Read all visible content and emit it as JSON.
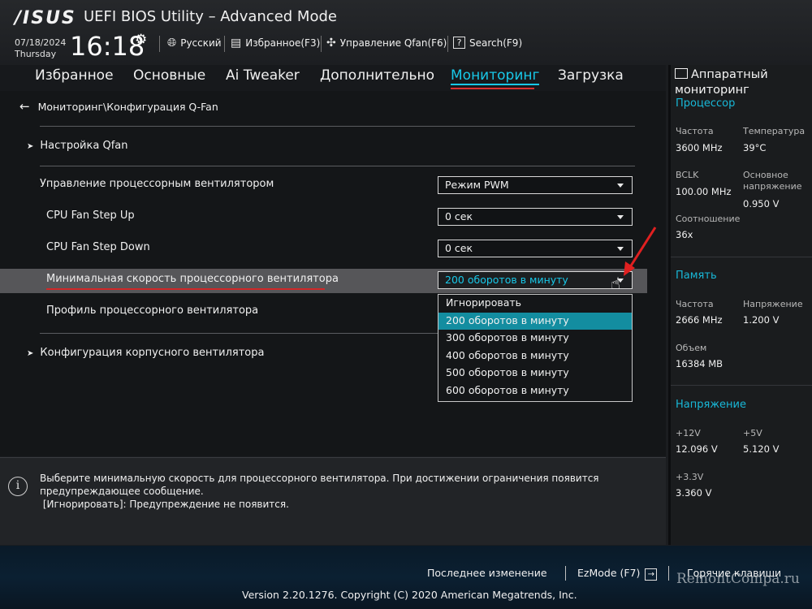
{
  "header": {
    "logo": "/ISUS",
    "title": "UEFI BIOS Utility – Advanced Mode",
    "date": "07/18/2024",
    "weekday": "Thursday",
    "time": "16:18",
    "language": "Русский",
    "favorites": "Избранное(F3)",
    "qfan": "Управление Qfan(F6)",
    "search_key": "?",
    "search": "Search(F9)"
  },
  "tabs": [
    {
      "label": "Избранное"
    },
    {
      "label": "Основные"
    },
    {
      "label": "Ai Tweaker"
    },
    {
      "label": "Дополнительно"
    },
    {
      "label": "Мониторинг",
      "active": true
    },
    {
      "label": "Загрузка"
    }
  ],
  "breadcrumb": "Мониторинг\\Конфигурация Q-Fan",
  "main": {
    "qfan_settings": "Настройка Qfan",
    "cpu_fan_control": {
      "label": "Управление процессорным вентилятором",
      "value": "Режим PWM"
    },
    "step_up": {
      "label": "CPU Fan Step Up",
      "value": "0 сек"
    },
    "step_down": {
      "label": "CPU Fan Step Down",
      "value": "0 сек"
    },
    "min_speed": {
      "label": "Минимальная скорость процессорного вентилятора",
      "value": "200 оборотов в минуту"
    },
    "fan_profile": {
      "label": "Профиль процессорного вентилятора"
    },
    "chassis_config": "Конфигурация корпусного вентилятора",
    "options": [
      "Игнорировать",
      "200 оборотов в минуту",
      "300 оборотов в минуту",
      "400 оборотов в минуту",
      "500 оборотов в минуту",
      "600 оборотов в минуту"
    ],
    "selected_option": 1
  },
  "info": {
    "line1": "Выберите минимальную скорость для процессорного вентилятора. При достижении ограничения появится",
    "line2": "предупреждающее сообщение.",
    "line3": " [Игнорировать]: Предупреждение не появится."
  },
  "footer": {
    "last_change": "Последнее изменение",
    "ezmode": "EzMode (F7)",
    "hotkeys": "Горячие клавиши",
    "version": "Version 2.20.1276. Copyright (C) 2020 American Megatrends, Inc.",
    "watermark": "RemontCompa.ru"
  },
  "hw_monitor": {
    "title": "Аппаратный мониторинг",
    "cpu": {
      "section": "Процессор",
      "freq_label": "Частота",
      "freq": "3600 MHz",
      "temp_label": "Температура",
      "temp": "39°C",
      "bclk_label": "BCLK",
      "bclk": "100.00 MHz",
      "core_v_label": "Основное напряжение",
      "core_v": "0.950 V",
      "ratio_label": "Соотношение",
      "ratio": "36x"
    },
    "memory": {
      "section": "Память",
      "freq_label": "Частота",
      "freq": "2666 MHz",
      "volt_label": "Напряжение",
      "volt": "1.200 V",
      "size_label": "Объем",
      "size": "16384 MB"
    },
    "voltage": {
      "section": "Напряжение",
      "v12_label": "+12V",
      "v12": "12.096 V",
      "v5_label": "+5V",
      "v5": "5.120 V",
      "v33_label": "+3.3V",
      "v33": "3.360 V"
    }
  },
  "colors": {
    "accent": "#18c8e8",
    "selected": "#138da0",
    "annotation": "#d83030"
  }
}
